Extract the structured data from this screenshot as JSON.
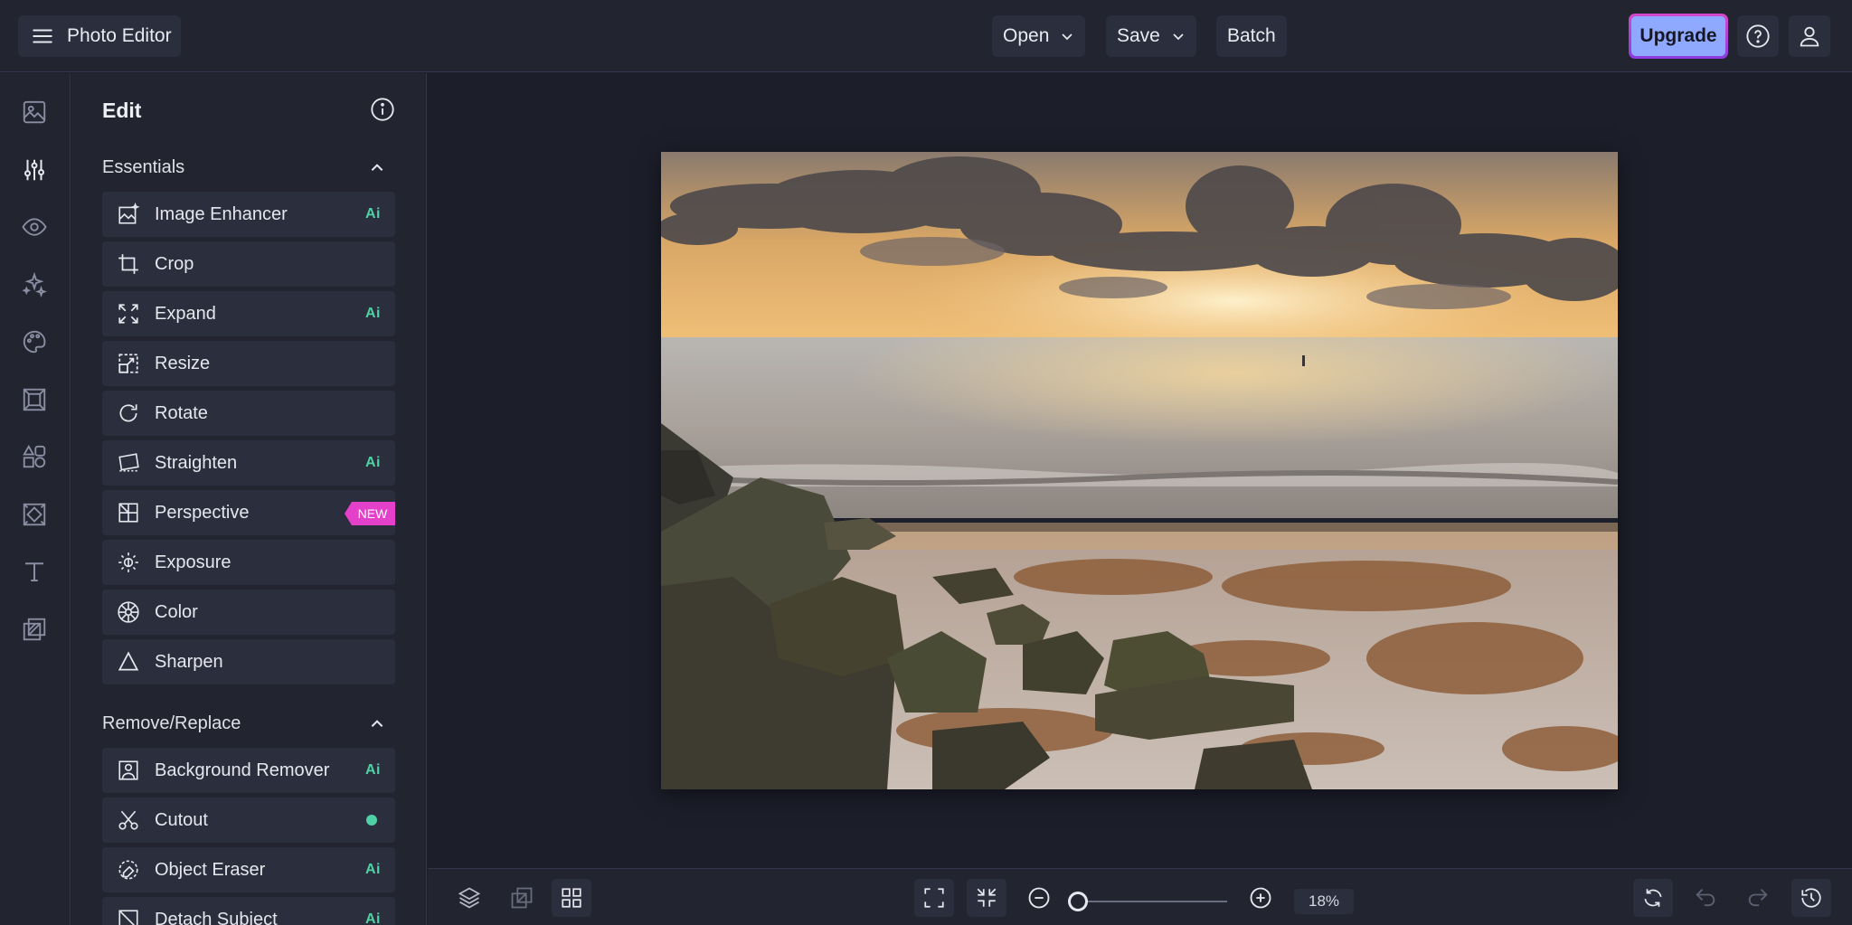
{
  "app": {
    "title": "Photo Editor"
  },
  "toolbar": {
    "open_label": "Open",
    "save_label": "Save",
    "batch_label": "Batch",
    "upgrade_label": "Upgrade"
  },
  "rail": {
    "items": [
      {
        "name": "image-icon"
      },
      {
        "name": "adjustments-icon"
      },
      {
        "name": "eye-icon"
      },
      {
        "name": "sparkles-icon"
      },
      {
        "name": "palette-icon"
      },
      {
        "name": "frame-icon"
      },
      {
        "name": "shapes-icon"
      },
      {
        "name": "texture-icon"
      },
      {
        "name": "text-icon"
      },
      {
        "name": "overlay-icon"
      }
    ]
  },
  "panel": {
    "title": "Edit",
    "sections": [
      {
        "title": "Essentials",
        "tools": [
          {
            "label": "Image Enhancer",
            "badge": "Ai"
          },
          {
            "label": "Crop",
            "badge": ""
          },
          {
            "label": "Expand",
            "badge": "Ai"
          },
          {
            "label": "Resize",
            "badge": ""
          },
          {
            "label": "Rotate",
            "badge": ""
          },
          {
            "label": "Straighten",
            "badge": "Ai"
          },
          {
            "label": "Perspective",
            "badge": "NEW"
          },
          {
            "label": "Exposure",
            "badge": ""
          },
          {
            "label": "Color",
            "badge": ""
          },
          {
            "label": "Sharpen",
            "badge": ""
          }
        ]
      },
      {
        "title": "Remove/Replace",
        "tools": [
          {
            "label": "Background Remover",
            "badge": "Ai"
          },
          {
            "label": "Cutout",
            "badge": "dot"
          },
          {
            "label": "Object Eraser",
            "badge": "Ai"
          },
          {
            "label": "Detach Subject",
            "badge": "Ai"
          }
        ]
      }
    ]
  },
  "zoom": {
    "value": "18%",
    "level": 0.18
  },
  "colors": {
    "accent": "#8ea9ff",
    "ai_badge": "#4fd1a5",
    "new_badge": "#e540c9",
    "upgrade_border": "#d548c9"
  }
}
